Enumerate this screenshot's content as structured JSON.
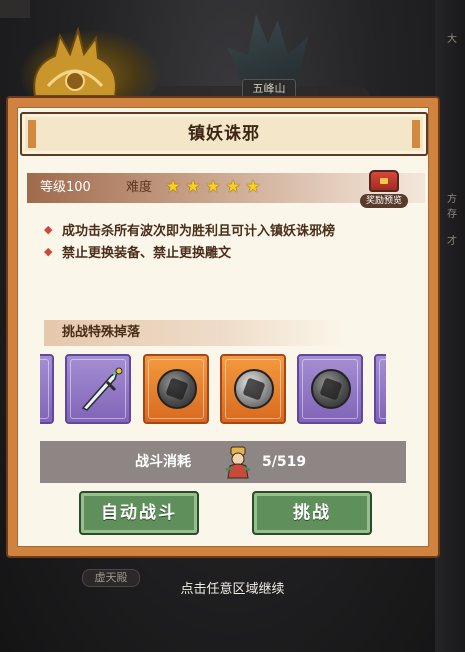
{
  "background": {
    "map_label_top": "五峰山",
    "map_label_bottom": "虚天殿",
    "right_labels": [
      "大",
      "方",
      "存",
      "才"
    ]
  },
  "dialog": {
    "title": "镇妖诛邪",
    "level_label": "等级100",
    "difficulty_label": "难度",
    "difficulty_stars": 5,
    "reward_preview_label": "奖励预览",
    "rules": [
      "成功击杀所有波次即为胜利且可计入镇妖诛邪榜",
      "禁止更换装备、禁止更换雕文"
    ],
    "drops_title": "挑战特殊掉落",
    "drop_items": [
      {
        "type": "purple",
        "icon": "item-partial-icon"
      },
      {
        "type": "purple",
        "icon": "jade-sword-icon"
      },
      {
        "type": "orange",
        "icon": "dark-stone-glyph-icon"
      },
      {
        "type": "orange",
        "icon": "light-stone-glyph-icon"
      },
      {
        "type": "purple",
        "icon": "grey-stone-glyph-icon"
      },
      {
        "type": "purple",
        "icon": "item-partial-icon"
      }
    ],
    "cost_label": "战斗消耗",
    "cost_value": "5/519",
    "cost_icon": "stamina-figure-icon",
    "auto_battle_label": "自动战斗",
    "challenge_label": "挑战"
  },
  "continue_hint": "点击任意区域继续",
  "colors": {
    "panel_orange": "#d0833f",
    "panel_cream": "#fbf6ea",
    "button_green": "#5f8f5b",
    "star_gold": "#f7d21a",
    "rare_purple": "#8064b8",
    "epic_orange": "#d86a1f"
  }
}
